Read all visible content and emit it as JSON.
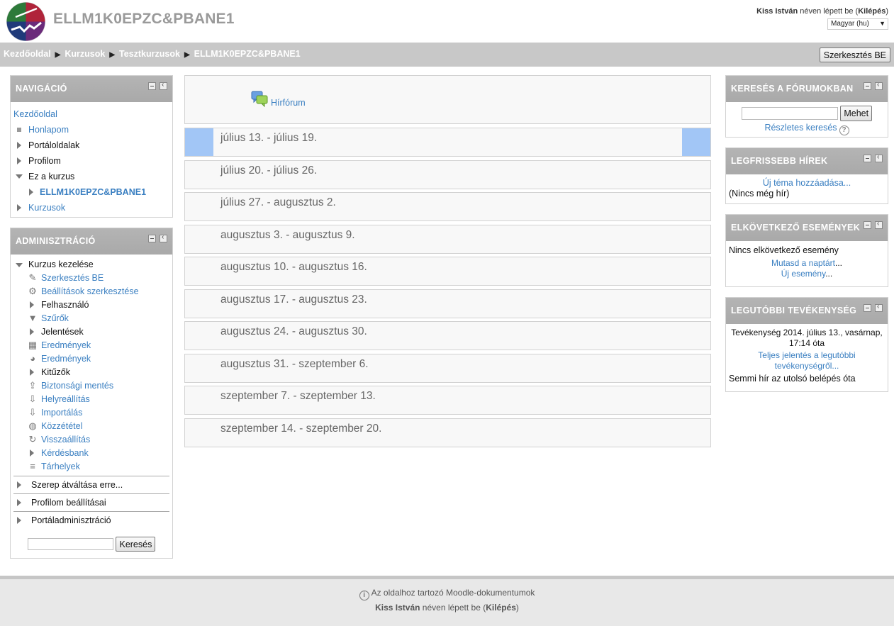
{
  "header": {
    "site_title": "ELLM1K0EPZC&PBANE1",
    "user_name": "Kiss István",
    "logged_in_text": "néven lépett be (",
    "logout_label": "Kilépés",
    "logged_in_close": ")",
    "language": "Magyar (hu)"
  },
  "navbar": {
    "breadcrumb": [
      "Kezdőoldal",
      "Kurzusok",
      "Tesztkurzusok",
      "ELLM1K0EPZC&PBANE1"
    ],
    "edit_button": "Szerkesztés BE"
  },
  "navigation": {
    "title": "NAVIGÁCIÓ",
    "home": "Kezdőoldal",
    "items": [
      "Honlapom",
      "Portáloldalak",
      "Profilom",
      "Ez a kurzus"
    ],
    "current_course": "ELLM1K0EPZC&PBANE1",
    "courses": "Kurzusok"
  },
  "administration": {
    "title": "ADMINISZTRÁCIÓ",
    "course_admin": "Kurzus kezelése",
    "items": [
      "Szerkesztés BE",
      "Beállítások szerkesztése",
      "Felhasználó",
      "Szűrők",
      "Jelentések",
      "Eredmények",
      "Eredmények",
      "Kitűzők",
      "Biztonsági mentés",
      "Helyreállítás",
      "Importálás",
      "Közzététel",
      "Visszaállítás",
      "Kérdésbank",
      "Tárhelyek"
    ],
    "sections": [
      "Szerep átváltása erre...",
      "Profilom beállításai",
      "Portáladminisztráció"
    ],
    "search_button": "Keresés"
  },
  "main": {
    "forum_link": "Hírfórum",
    "weeks": [
      "július 13. - július 19.",
      "július 20. - július 26.",
      "július 27. - augusztus 2.",
      "augusztus 3. - augusztus 9.",
      "augusztus 10. - augusztus 16.",
      "augusztus 17. - augusztus 23.",
      "augusztus 24. - augusztus 30.",
      "augusztus 31. - szeptember 6.",
      "szeptember 7. - szeptember 13.",
      "szeptember 14. - szeptember 20."
    ]
  },
  "forum_search": {
    "title": "KERESÉS A FÓRUMOKBAN",
    "button": "Mehet",
    "advanced": "Részletes keresés"
  },
  "latest_news": {
    "title": "LEGFRISSEBB HÍREK",
    "add": "Új téma hozzáadása...",
    "empty": "(Nincs még hír)"
  },
  "upcoming": {
    "title": "ELKÖVETKEZŐ ESEMÉNYEK",
    "empty": "Nincs elkövetkező esemény",
    "calendar": "Mutasd a naptárt",
    "calendar_dots": "...",
    "new_event": "Új esemény",
    "new_event_dots": "..."
  },
  "recent": {
    "title": "LEGUTÓBBI TEVÉKENYSÉG",
    "since": "Tevékenység 2014. július 13., vasárnap, 17:14 óta",
    "full_report": "Teljes jelentés a legutóbbi tevékenységről...",
    "nothing": "Semmi hír az utolsó belépés óta"
  },
  "footer": {
    "docs": "Az oldalhoz tartozó Moodle-dokumentumok",
    "user_name": "Kiss István",
    "logged_in_text": " néven lépett be (",
    "logout_label": "Kilépés",
    "logged_in_close": ")"
  },
  "colors": {
    "link": "#3a7fc1",
    "block_header": "#b0b0b0",
    "current_week": "#a2c6f6"
  }
}
